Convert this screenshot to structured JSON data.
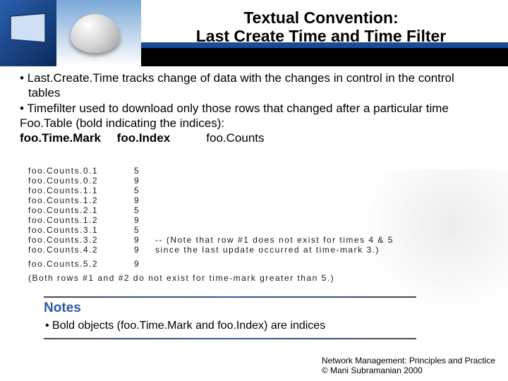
{
  "title": {
    "line1": "Textual Convention:",
    "line2": "Last Create Time and Time Filter"
  },
  "bullets": [
    "Last.Create.Time tracks change of data with the changes in control in the control tables",
    "Timefilter used to download only those rows that changed after a particular time"
  ],
  "table_intro": "Foo.Table (bold indicating the indices):",
  "columns": {
    "c1": "foo.Time.Mark",
    "c2": "foo.Index",
    "c3": "foo.Counts"
  },
  "data_rows": [
    {
      "label": "foo.Counts.0.1",
      "value": "5",
      "note": ""
    },
    {
      "label": "foo.Counts.0.2",
      "value": "9",
      "note": ""
    },
    {
      "label": "foo.Counts.1.1",
      "value": "5",
      "note": ""
    },
    {
      "label": "foo.Counts.1.2",
      "value": "9",
      "note": ""
    },
    {
      "label": "foo.Counts.2.1",
      "value": "5",
      "note": ""
    },
    {
      "label": "foo.Counts.1.2",
      "value": "9",
      "note": ""
    },
    {
      "label": "foo.Counts.3.1",
      "value": "5",
      "note": ""
    },
    {
      "label": "foo.Counts.3.2",
      "value": "9",
      "note": "-- (Note that row #1 does not exist for times 4 & 5"
    },
    {
      "label": "foo.Counts.4.2",
      "value": "9",
      "note": "     since the last update occurred at time-mark 3.)"
    }
  ],
  "gap_row": {
    "label": "foo.Counts.5.2",
    "value": "9",
    "note": ""
  },
  "paren_note": "(Both rows #1 and #2 do not exist for time-mark greater than 5.)",
  "notes": {
    "heading": "Notes",
    "body": "Bold objects (foo.Time.Mark and foo.Index) are indices"
  },
  "footer": {
    "line1": "Network Management: Principles and Practice",
    "line2": "©  Mani Subramanian 2000"
  }
}
